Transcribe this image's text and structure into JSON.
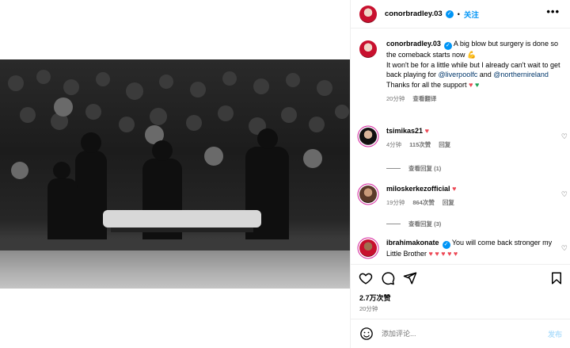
{
  "header": {
    "username": "conorbradley.03",
    "follow_label": "关注",
    "more_label": "•••"
  },
  "caption": {
    "username": "conorbradley.03",
    "line1": "A big blow but surgery is done so the comeback starts now 💪",
    "line2_pre": "It won't be for a little while but I already can't wait to get back playing for ",
    "mention1": "@liverpoolfc",
    "line2_mid": " and ",
    "mention2": "@northernireland",
    "line3": "Thanks for all the support",
    "time": "20分钟",
    "translate": "查看翻译"
  },
  "comments": [
    {
      "username": "tsimikas21",
      "text": "",
      "time": "4分钟",
      "likes": "115次赞",
      "reply": "回复",
      "view_replies": "查看回复 (1)"
    },
    {
      "username": "miloskerkezofficial",
      "text": "",
      "time": "19分钟",
      "likes": "864次赞",
      "reply": "回复",
      "view_replies": "查看回复 (3)"
    },
    {
      "username": "ibrahimakonate",
      "text": "You will come back stronger my Little Brother"
    }
  ],
  "stats": {
    "likes": "2.7万次赞",
    "time": "20分钟"
  },
  "composer": {
    "placeholder": "添加评论...",
    "post_label": "发布"
  },
  "colors": {
    "accent": "#0095f6",
    "heart_red": "#ed4956",
    "heart_green": "#1fa055"
  },
  "icons": [
    "heart-icon",
    "comment-icon",
    "share-icon",
    "bookmark-icon",
    "emoji-icon",
    "verified-icon",
    "more-icon"
  ]
}
